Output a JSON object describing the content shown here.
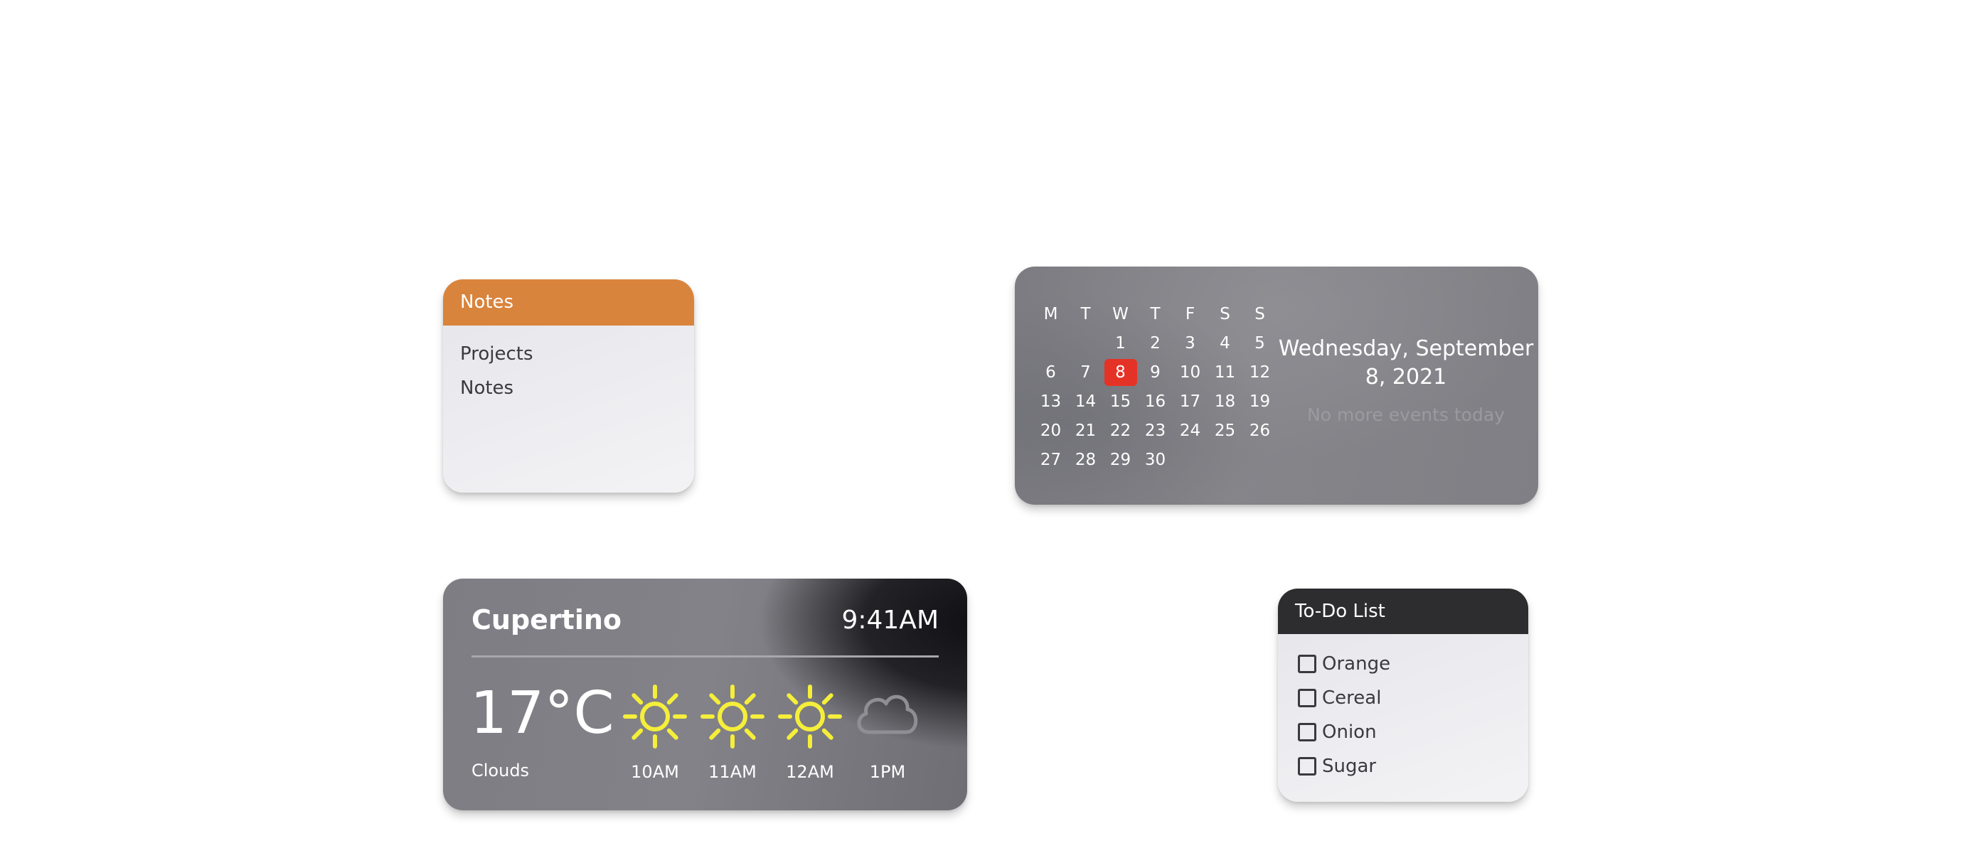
{
  "notes": {
    "title": "Notes",
    "items": [
      "Projects",
      "Notes"
    ],
    "accent": "#d9843c"
  },
  "calendar": {
    "weekdays": [
      "M",
      "T",
      "W",
      "T",
      "F",
      "S",
      "S"
    ],
    "weeks": [
      [
        "",
        "",
        "1",
        "2",
        "3",
        "4",
        "5"
      ],
      [
        "6",
        "7",
        "8",
        "9",
        "10",
        "11",
        "12"
      ],
      [
        "13",
        "14",
        "15",
        "16",
        "17",
        "18",
        "19"
      ],
      [
        "20",
        "21",
        "22",
        "23",
        "24",
        "25",
        "26"
      ],
      [
        "27",
        "28",
        "29",
        "30",
        "",
        "",
        ""
      ]
    ],
    "today": "8",
    "today_color": "#e53226",
    "date_text": "Wednesday, September 8, 2021",
    "events_text": "No more events today"
  },
  "weather": {
    "city": "Cupertino",
    "time": "9:41AM",
    "temperature": "17°C",
    "condition": "Clouds",
    "forecast": [
      {
        "time": "10AM",
        "icon": "sun-icon"
      },
      {
        "time": "11AM",
        "icon": "sun-icon"
      },
      {
        "time": "12AM",
        "icon": "sun-icon"
      },
      {
        "time": "1PM",
        "icon": "cloud-icon"
      }
    ],
    "sun_color": "#f5ee3a"
  },
  "todo": {
    "title": "To-Do List",
    "items": [
      {
        "label": "Orange",
        "checked": false
      },
      {
        "label": "Cereal",
        "checked": false
      },
      {
        "label": "Onion",
        "checked": false
      },
      {
        "label": "Sugar",
        "checked": false
      }
    ]
  }
}
